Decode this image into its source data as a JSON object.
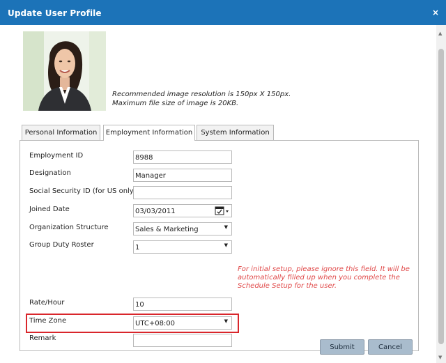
{
  "dialog": {
    "title": "Update User Profile",
    "close_icon": "close-icon",
    "close_glyph": "×"
  },
  "photo": {
    "note_line1": "Recommended image resolution is 150px X 150px.",
    "note_line2": "Maximum file size of image is 20KB."
  },
  "tabs": [
    {
      "label": "Personal Information",
      "active": false
    },
    {
      "label": "Employment Information",
      "active": true
    },
    {
      "label": "System Information",
      "active": false
    }
  ],
  "form": {
    "employment_id": {
      "label": "Employment ID",
      "value": "8988"
    },
    "designation": {
      "label": "Designation",
      "value": "Manager"
    },
    "ssn": {
      "label": "Social Security ID (for US only)",
      "value": ""
    },
    "joined_date": {
      "label": "Joined Date",
      "value": "03/03/2011",
      "icon": "calendar-icon"
    },
    "org_structure": {
      "label": "Organization Structure",
      "value": "Sales & Marketing"
    },
    "duty_roster": {
      "label": "Group Duty Roster",
      "value": "1"
    },
    "rate_hour": {
      "label": "Rate/Hour",
      "value": "10"
    },
    "time_zone": {
      "label": "Time Zone",
      "value": "UTC+08:00"
    },
    "remark": {
      "label": "Remark",
      "value": ""
    }
  },
  "hint": {
    "duty_roster": "For initial setup, please ignore this field. It will be automatically filled up when you complete the Schedule Setup for the user."
  },
  "buttons": {
    "submit": "Submit",
    "cancel": "Cancel"
  },
  "glyphs": {
    "dropdown_arrow": "▼",
    "scroll_up": "▲",
    "scroll_down": "▼"
  },
  "colors": {
    "titlebar": "#1c73b8",
    "hint_text": "#e04848",
    "highlight_border": "#d9262b",
    "button_bg": "#a9bccd"
  }
}
